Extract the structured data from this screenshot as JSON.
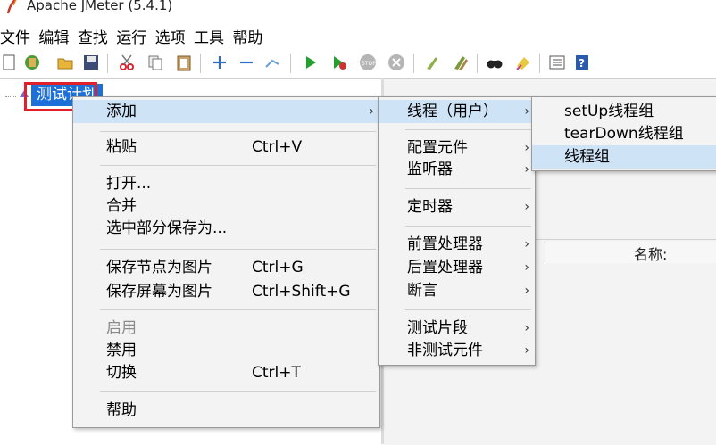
{
  "window": {
    "title": "Apache JMeter (5.4.1)",
    "app_icon": "feather-icon"
  },
  "menubar": {
    "items": [
      "文件",
      "编辑",
      "查找",
      "运行",
      "选项",
      "工具",
      "帮助"
    ]
  },
  "toolbar": {
    "icons": [
      "new-icon",
      "templates-icon",
      "open-icon",
      "save-icon",
      "cut-icon",
      "copy-icon",
      "paste-icon",
      "expand-icon",
      "collapse-icon",
      "toggle-icon",
      "start-icon",
      "start-no-pause-icon",
      "stop-icon",
      "shutdown-icon",
      "clear-icon",
      "clear-all-icon",
      "search-icon",
      "reset-search-icon",
      "function-helper-icon",
      "help-icon"
    ]
  },
  "tree": {
    "root_label": "测试计划"
  },
  "right_panel": {
    "name_label": "名称:"
  },
  "context_menu": {
    "items": [
      {
        "label": "添加",
        "submenu": true,
        "active": true
      },
      {
        "label": "粘贴",
        "shortcut": "Ctrl+V"
      },
      {
        "label": "打开..."
      },
      {
        "label": "合并"
      },
      {
        "label": "选中部分保存为..."
      },
      {
        "label": "保存节点为图片",
        "shortcut": "Ctrl+G"
      },
      {
        "label": "保存屏幕为图片",
        "shortcut": "Ctrl+Shift+G"
      },
      {
        "label": "启用",
        "disabled": true
      },
      {
        "label": "禁用"
      },
      {
        "label": "切换",
        "shortcut": "Ctrl+T"
      },
      {
        "label": "帮助"
      }
    ]
  },
  "add_menu": {
    "items": [
      {
        "label": "线程（用户）",
        "active": true
      },
      {
        "label": "配置元件"
      },
      {
        "label": "监听器"
      },
      {
        "label": "定时器"
      },
      {
        "label": "前置处理器"
      },
      {
        "label": "后置处理器"
      },
      {
        "label": "断言"
      },
      {
        "label": "测试片段"
      },
      {
        "label": "非测试元件"
      }
    ]
  },
  "thread_menu": {
    "items": [
      {
        "label": "setUp线程组"
      },
      {
        "label": "tearDown线程组"
      },
      {
        "label": "线程组",
        "active": true
      }
    ]
  },
  "colors": {
    "selection": "#1c70d8",
    "menu_highlight": "#cfe3f7",
    "annotation_box": "#e0202a"
  }
}
